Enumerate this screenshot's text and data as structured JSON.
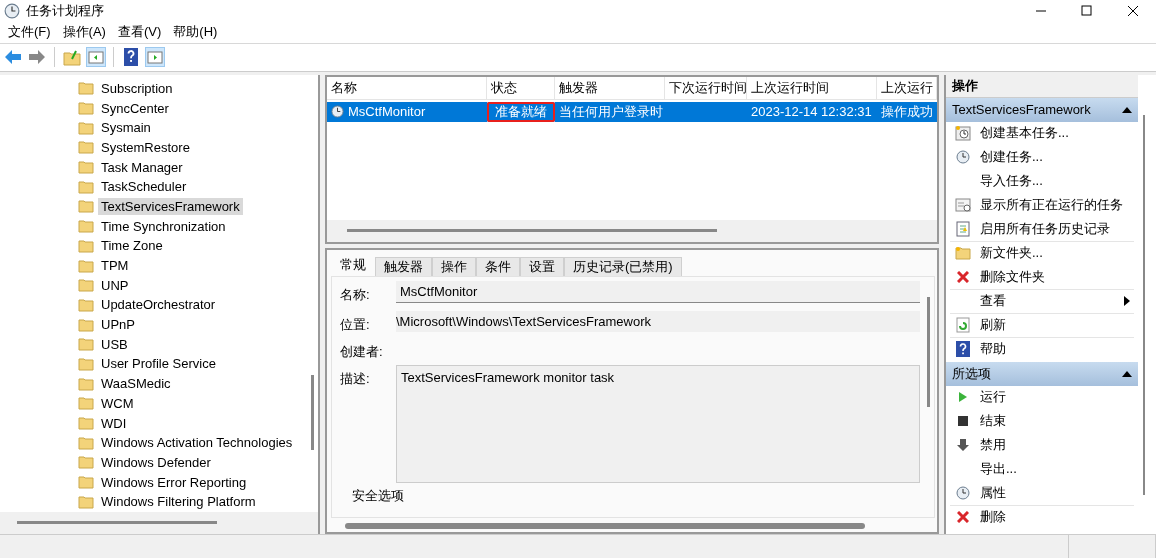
{
  "window": {
    "title": "任务计划程序"
  },
  "menu": [
    "文件(F)",
    "操作(A)",
    "查看(V)",
    "帮助(H)"
  ],
  "tree": {
    "items": [
      {
        "label": "Subscription",
        "selected": false
      },
      {
        "label": "SyncCenter",
        "selected": false
      },
      {
        "label": "Sysmain",
        "selected": false
      },
      {
        "label": "SystemRestore",
        "selected": false
      },
      {
        "label": "Task Manager",
        "selected": false
      },
      {
        "label": "TaskScheduler",
        "selected": false
      },
      {
        "label": "TextServicesFramework",
        "selected": true
      },
      {
        "label": "Time Synchronization",
        "selected": false
      },
      {
        "label": "Time Zone",
        "selected": false
      },
      {
        "label": "TPM",
        "selected": false
      },
      {
        "label": "UNP",
        "selected": false
      },
      {
        "label": "UpdateOrchestrator",
        "selected": false
      },
      {
        "label": "UPnP",
        "selected": false
      },
      {
        "label": "USB",
        "selected": false
      },
      {
        "label": "User Profile Service",
        "selected": false
      },
      {
        "label": "WaaSMedic",
        "selected": false
      },
      {
        "label": "WCM",
        "selected": false
      },
      {
        "label": "WDI",
        "selected": false
      },
      {
        "label": "Windows Activation Technologies",
        "selected": false
      },
      {
        "label": "Windows Defender",
        "selected": false
      },
      {
        "label": "Windows Error Reporting",
        "selected": false
      },
      {
        "label": "Windows Filtering Platform",
        "selected": false
      }
    ]
  },
  "table": {
    "columns": [
      "名称",
      "状态",
      "触发器",
      "下次运行时间",
      "上次运行时间",
      "上次运行"
    ],
    "rows": [
      {
        "selected": true,
        "cells": [
          {
            "text": "MsCtfMonitor",
            "highlighted": false
          },
          {
            "text": "准备就绪",
            "highlighted": true
          },
          {
            "text": "当任何用户登录时",
            "highlighted": false
          },
          {
            "text": "",
            "highlighted": false
          },
          {
            "text": "2023-12-14 12:32:31",
            "highlighted": false
          },
          {
            "text": "操作成功",
            "highlighted": false
          }
        ]
      }
    ]
  },
  "detail": {
    "tabs": [
      {
        "label": "常规",
        "selected": true
      },
      {
        "label": "触发器",
        "selected": false
      },
      {
        "label": "操作",
        "selected": false
      },
      {
        "label": "条件",
        "selected": false
      },
      {
        "label": "设置",
        "selected": false
      },
      {
        "label": "历史记录(已禁用)",
        "selected": false
      }
    ],
    "fields": [
      {
        "kind": "input",
        "label": "名称:",
        "value": "MsCtfMonitor"
      },
      {
        "kind": "readonly",
        "label": "位置:",
        "value": "\\Microsoft\\Windows\\TextServicesFramework"
      },
      {
        "kind": "empty",
        "label": "创建者:"
      },
      {
        "kind": "textarea",
        "label": "描述:",
        "value": "TextServicesFramework monitor task"
      }
    ],
    "group_title": "安全选项"
  },
  "actions": {
    "title": "操作",
    "sections": [
      {
        "title": "TextServicesFramework",
        "expanded": true,
        "items": [
          {
            "label": "创建基本任务...",
            "kind": "wizard",
            "submenu": false,
            "separator": false
          },
          {
            "label": "创建任务...",
            "kind": "clock",
            "submenu": false,
            "separator": false
          },
          {
            "label": "导入任务...",
            "kind": "plain",
            "submenu": false,
            "separator": false
          },
          {
            "label": "显示所有正在运行的任务",
            "kind": "list",
            "submenu": false,
            "separator": false
          },
          {
            "label": "启用所有任务历史记录",
            "kind": "log",
            "submenu": false,
            "separator": true
          },
          {
            "label": "新文件夹...",
            "kind": "folder",
            "submenu": false,
            "separator": false
          },
          {
            "label": "删除文件夹",
            "kind": "delete",
            "submenu": false,
            "separator": true
          },
          {
            "label": "查看",
            "kind": "plain",
            "submenu": true,
            "separator": true
          },
          {
            "label": "刷新",
            "kind": "refresh",
            "submenu": false,
            "separator": true
          },
          {
            "label": "帮助",
            "kind": "help",
            "submenu": false,
            "separator": false
          }
        ]
      },
      {
        "title": "所选项",
        "expanded": true,
        "items": [
          {
            "label": "运行",
            "kind": "run",
            "submenu": false,
            "separator": false
          },
          {
            "label": "结束",
            "kind": "stop",
            "submenu": false,
            "separator": false
          },
          {
            "label": "禁用",
            "kind": "disable",
            "submenu": false,
            "separator": false
          },
          {
            "label": "导出...",
            "kind": "plain",
            "submenu": false,
            "separator": false
          },
          {
            "label": "属性",
            "kind": "clock",
            "submenu": false,
            "separator": true
          },
          {
            "label": "删除",
            "kind": "delete",
            "submenu": false,
            "separator": false
          }
        ]
      }
    ]
  }
}
